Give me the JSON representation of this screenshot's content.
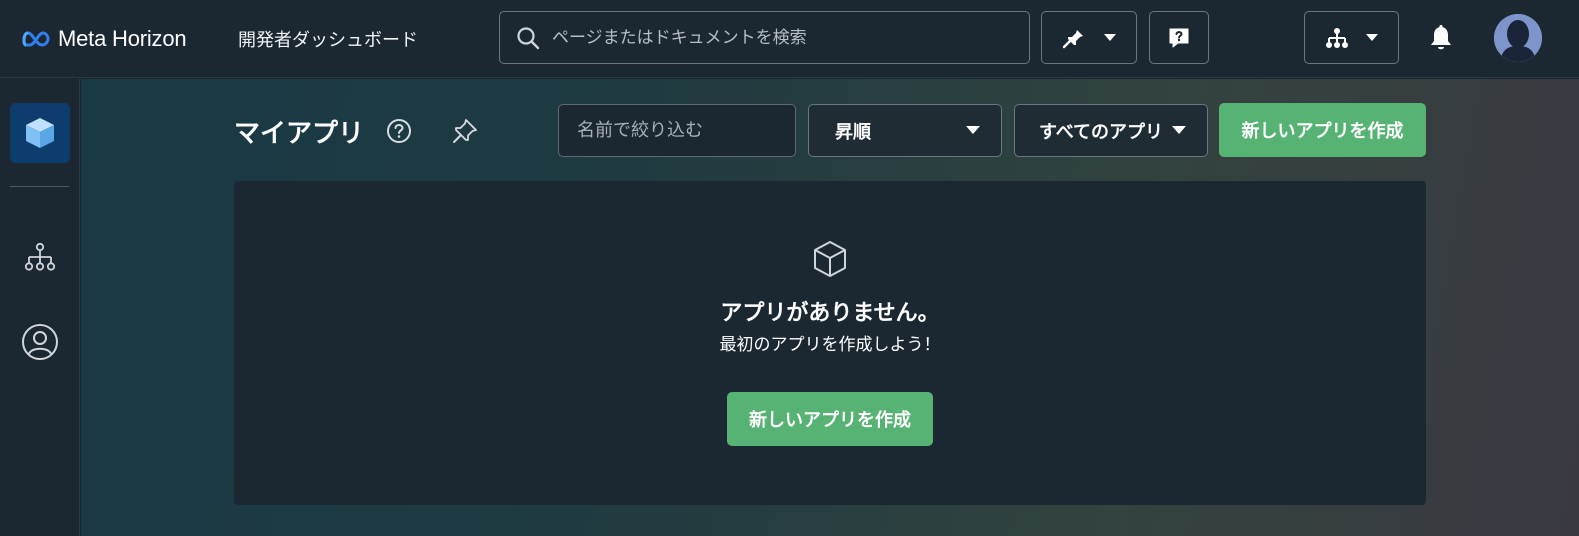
{
  "header": {
    "brand": "Meta Horizon",
    "subtitle": "開発者ダッシュボード",
    "search_placeholder": "ページまたはドキュメントを検索",
    "icons": [
      "meta-logo-icon",
      "search-icon",
      "pin-icon",
      "chevron-down-icon",
      "help-bubble-icon",
      "org-tree-icon",
      "bell-icon",
      "avatar"
    ]
  },
  "sidebar": {
    "items": [
      {
        "name": "apps",
        "icon": "cube-icon",
        "active": true
      },
      {
        "name": "organization",
        "icon": "org-tree-icon",
        "active": false
      },
      {
        "name": "account",
        "icon": "user-circle-icon",
        "active": false
      }
    ]
  },
  "main": {
    "title": "マイアプリ",
    "filter_placeholder": "名前で絞り込む",
    "sort_label": "昇順",
    "scope_label": "すべてのアプリ",
    "create_label": "新しいアプリを作成",
    "empty": {
      "title": "アプリがありません。",
      "subtitle": "最初のアプリを作成しよう！",
      "button": "新しいアプリを作成"
    }
  },
  "colors": {
    "accent_green": "#56b373",
    "active_blue": "#0d3d6e",
    "panel": "#1c2831"
  }
}
